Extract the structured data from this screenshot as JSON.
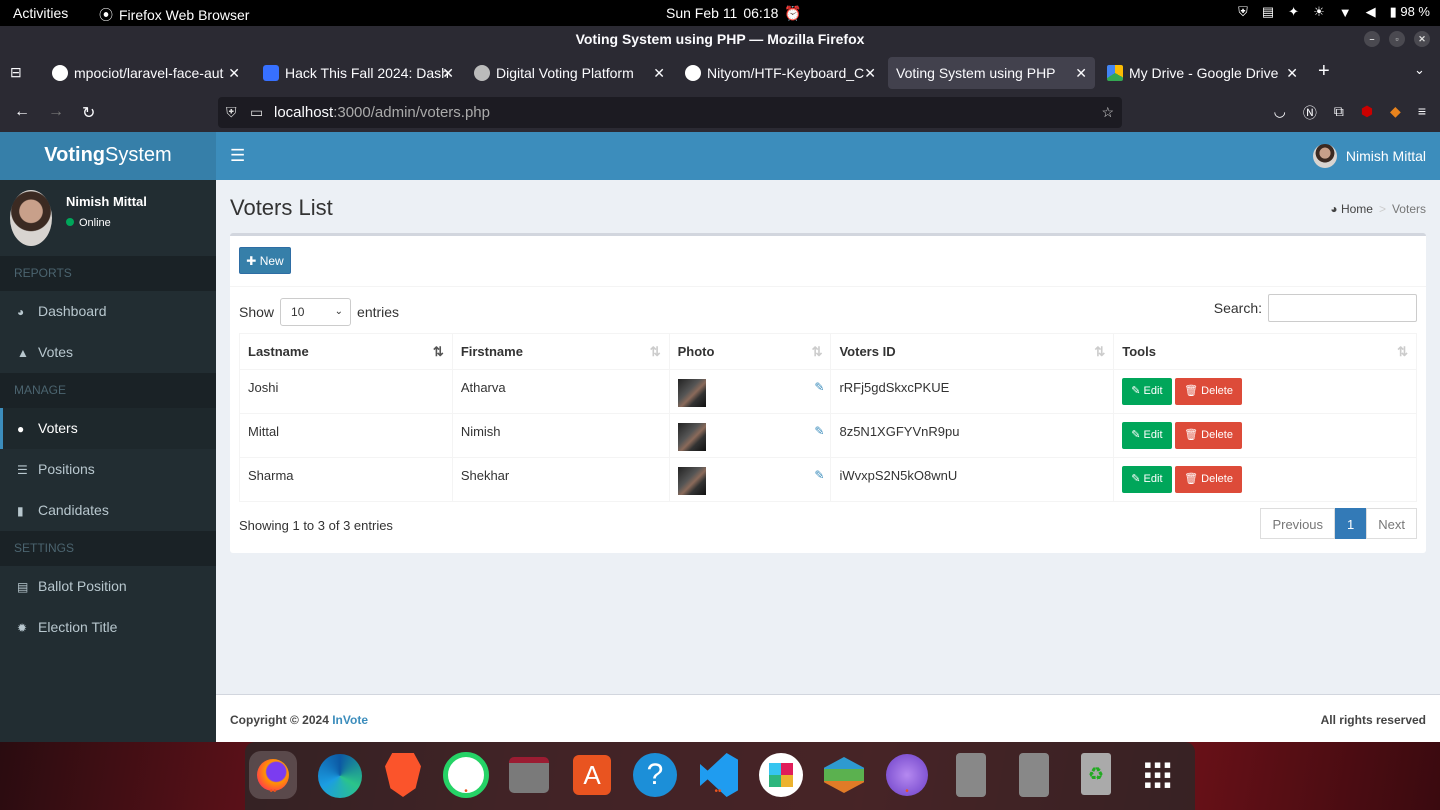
{
  "system": {
    "activities": "Activities",
    "app": "Firefox Web Browser",
    "date": "Sun Feb 11",
    "time": "06:18",
    "battery": "98 %"
  },
  "browser": {
    "window_title": "Voting System using PHP — Mozilla Firefox",
    "tabs": [
      {
        "label": "mpociot/laravel-face-aut",
        "icon": "github-icon",
        "color": "#ffffff"
      },
      {
        "label": "Hack This Fall 2024: Dash",
        "icon": "devfolio-icon",
        "color": "#3770ff"
      },
      {
        "label": "Digital Voting Platform",
        "icon": "openai-icon",
        "color": "#bbbbbb"
      },
      {
        "label": "Nityom/HTF-Keyboard_C",
        "icon": "github-icon",
        "color": "#ffffff"
      },
      {
        "label": "Voting System using PHP",
        "icon": "",
        "color": ""
      },
      {
        "label": "My Drive - Google Drive",
        "icon": "google-drive-icon",
        "color": "#fbbc04"
      }
    ],
    "url_host": "localhost",
    "url_rest": ":3000/admin/voters.php"
  },
  "app": {
    "logo_bold": "Voting",
    "logo_rest": "System",
    "header_user": "Nimish Mittal",
    "user_name": "Nimish Mittal",
    "user_status": "Online",
    "menu": {
      "reports_header": "REPORTS",
      "dashboard": "Dashboard",
      "votes": "Votes",
      "manage_header": "MANAGE",
      "voters": "Voters",
      "positions": "Positions",
      "candidates": "Candidates",
      "settings_header": "SETTINGS",
      "ballot_position": "Ballot Position",
      "election_title": "Election Title"
    },
    "page_title": "Voters List",
    "breadcrumb_home": "Home",
    "breadcrumb_current": "Voters",
    "new_button": "New",
    "show_label": "Show",
    "entries_value": "10",
    "entries_label": "entries",
    "search_label": "Search:",
    "columns": [
      "Lastname",
      "Firstname",
      "Photo",
      "Voters ID",
      "Tools"
    ],
    "rows": [
      {
        "lastname": "Joshi",
        "firstname": "Atharva",
        "voter_id": "rRFj5gdSkxcPKUE"
      },
      {
        "lastname": "Mittal",
        "firstname": "Nimish",
        "voter_id": "8z5N1XGFYVnR9pu"
      },
      {
        "lastname": "Sharma",
        "firstname": "Shekhar",
        "voter_id": "iWvxpS2N5kO8wnU"
      }
    ],
    "edit_label": "Edit",
    "delete_label": "Delete",
    "info": "Showing 1 to 3 of 3 entries",
    "pagination": {
      "previous": "Previous",
      "page": "1",
      "next": "Next"
    },
    "footer_copyright": "Copyright © 2024",
    "footer_brand": "InVote",
    "footer_rights": "All rights reserved"
  }
}
